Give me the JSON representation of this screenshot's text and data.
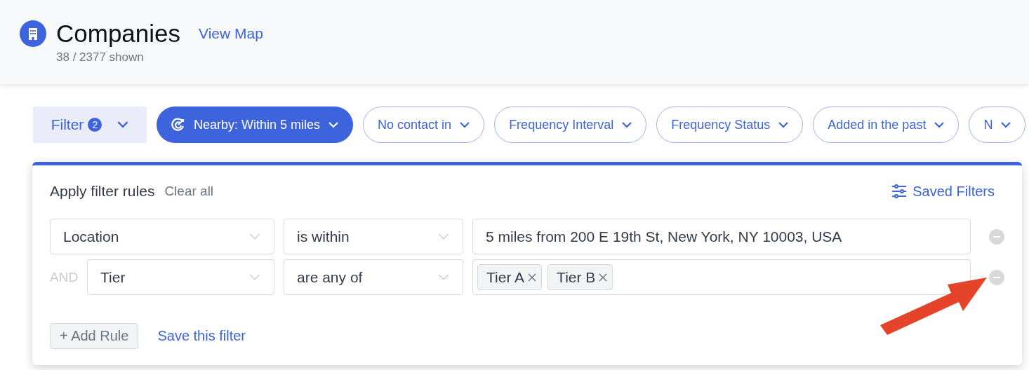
{
  "header": {
    "title": "Companies",
    "link": "View Map",
    "count": "38 / 2377 shown"
  },
  "filter_button": {
    "label": "Filter",
    "badge": "2",
    "expanded": true
  },
  "chips": [
    {
      "label": "Nearby: Within 5 miles",
      "active": true,
      "icon": true
    },
    {
      "label": "No contact in",
      "active": false
    },
    {
      "label": "Frequency Interval",
      "active": false
    },
    {
      "label": "Frequency Status",
      "active": false
    },
    {
      "label": "Added in the past",
      "active": false
    },
    {
      "label": "N",
      "active": false
    }
  ],
  "panel": {
    "title": "Apply filter rules",
    "clear": "Clear all",
    "saved": "Saved Filters",
    "rules": [
      {
        "field": "Location",
        "operator": "is within",
        "kind": "text",
        "value": "5 miles from 200 E 19th St, New York, NY 10003, USA"
      },
      {
        "conjunction": "AND",
        "field": "Tier",
        "operator": "are any of",
        "kind": "tags",
        "tags": [
          "Tier A",
          "Tier B"
        ]
      }
    ],
    "add_rule": "+ Add Rule",
    "save": "Save this filter"
  },
  "annotation": {
    "kind": "arrow"
  }
}
